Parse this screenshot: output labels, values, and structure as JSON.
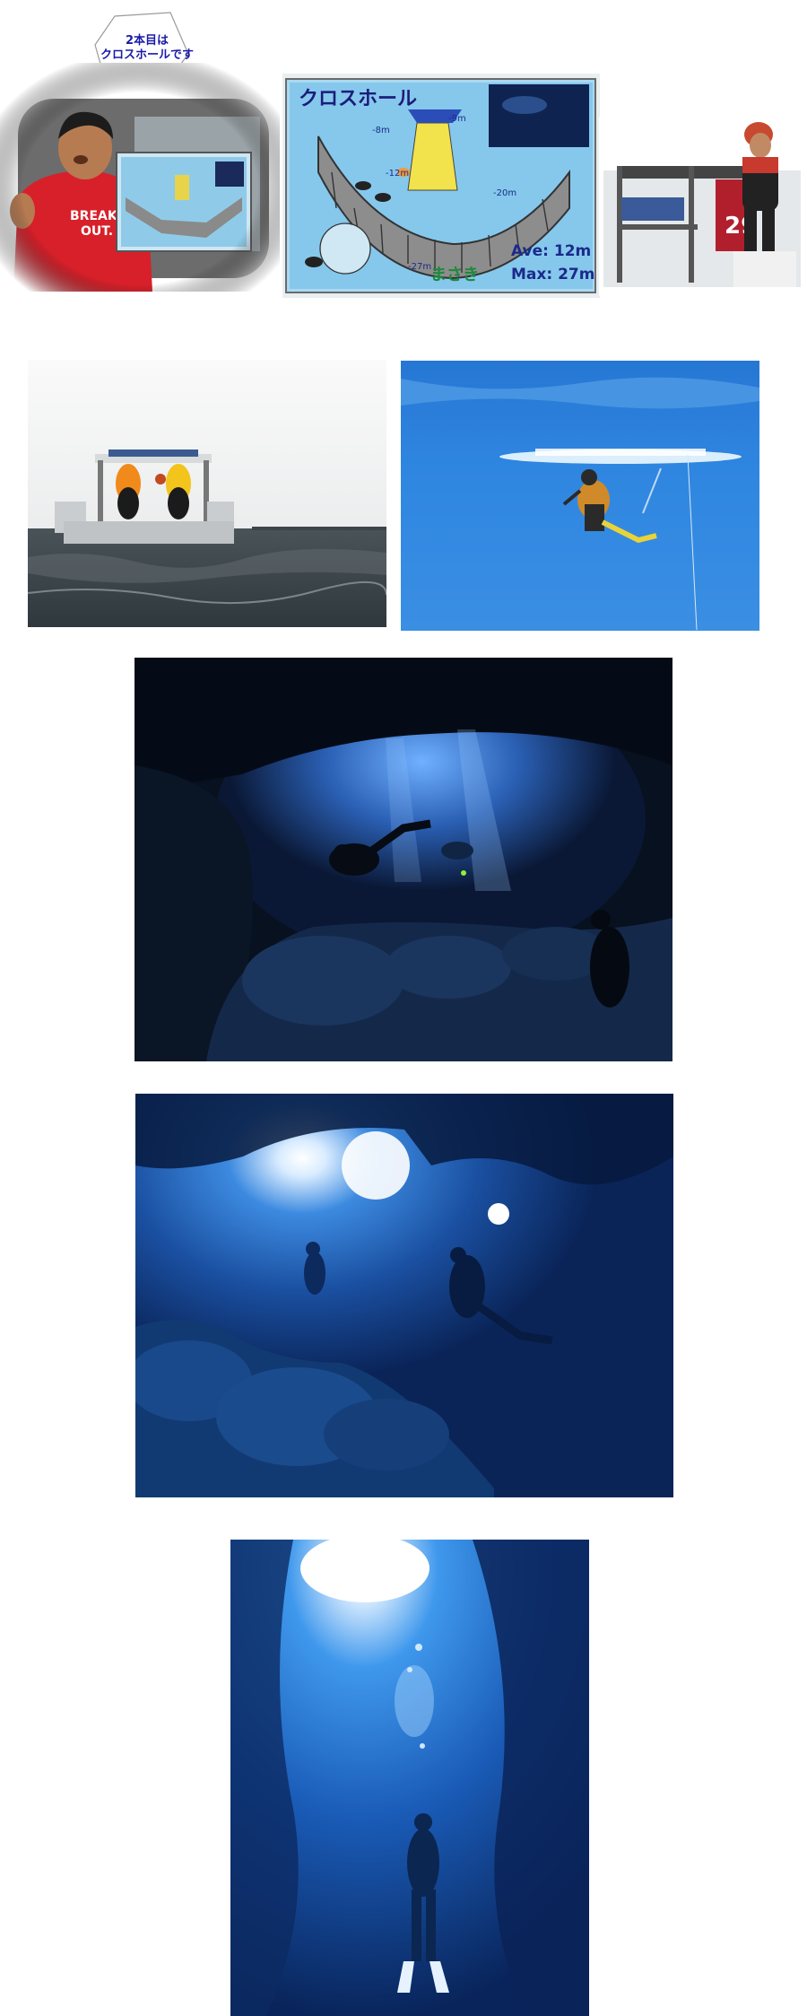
{
  "bubble": {
    "line1": "2本目は",
    "line2": "クロスホールです"
  },
  "dive_map": {
    "title": "クロスホール",
    "depth_marks": [
      "-8m",
      "-9m",
      "-12m",
      "-20m",
      "-27m"
    ],
    "stats": {
      "avg": "Ave: 12m",
      "max": "Max: 27m"
    },
    "signature": "まさき"
  },
  "boat_sign": "29",
  "colors": {
    "sea": "#2e7fd6",
    "cave_dark": "#0a1a3a",
    "sign_bg": "#9fd3ef"
  }
}
